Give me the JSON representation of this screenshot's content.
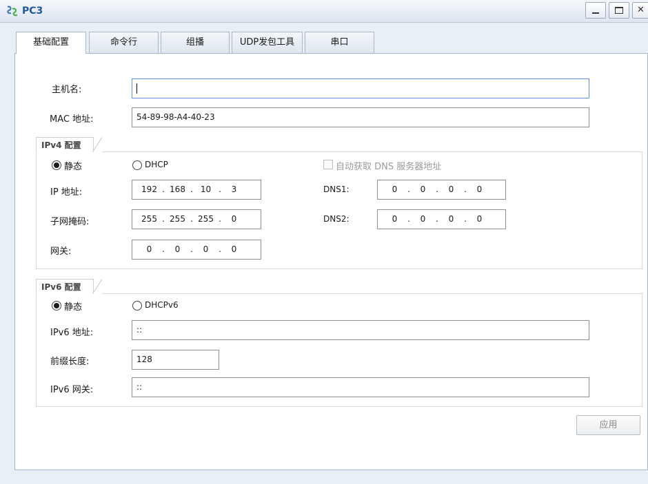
{
  "window": {
    "title": "PC3",
    "icon": "network-pc-icon"
  },
  "tabs": [
    {
      "label": "基础配置",
      "active": true
    },
    {
      "label": "命令行",
      "active": false
    },
    {
      "label": "组播",
      "active": false
    },
    {
      "label": "UDP发包工具",
      "active": false
    },
    {
      "label": "串口",
      "active": false
    }
  ],
  "basic": {
    "hostname_label": "主机名:",
    "hostname_value": "",
    "mac_label": "MAC 地址:",
    "mac_value": "54-89-98-A4-40-23"
  },
  "ipv4": {
    "title": "IPv4 配置",
    "static_label": "静态",
    "dhcp_label": "DHCP",
    "mode": "static",
    "auto_dns_label": "自动获取 DNS 服务器地址",
    "auto_dns_checked": false,
    "ip_label": "IP 地址:",
    "ip": [
      "192",
      "168",
      "10",
      "3"
    ],
    "mask_label": "子网掩码:",
    "mask": [
      "255",
      "255",
      "255",
      "0"
    ],
    "gateway_label": "网关:",
    "gateway": [
      "0",
      "0",
      "0",
      "0"
    ],
    "dns1_label": "DNS1:",
    "dns1": [
      "0",
      "0",
      "0",
      "0"
    ],
    "dns2_label": "DNS2:",
    "dns2": [
      "0",
      "0",
      "0",
      "0"
    ]
  },
  "ipv6": {
    "title": "IPv6 配置",
    "static_label": "静态",
    "dhcp_label": "DHCPv6",
    "mode": "static",
    "address_label": "IPv6 地址:",
    "address_value": "::",
    "prefix_label": "前缀长度:",
    "prefix_value": "128",
    "gateway_label": "IPv6 网关:",
    "gateway_value": "::"
  },
  "apply_label": "应用"
}
